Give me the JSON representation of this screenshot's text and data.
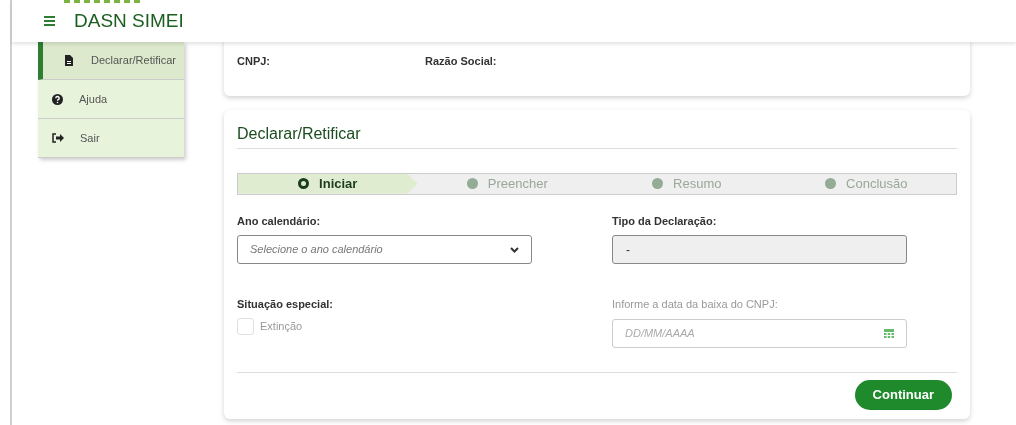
{
  "header": {
    "title": "DASN SIMEI"
  },
  "sidebar": {
    "items": [
      {
        "label": "Declarar/Retificar",
        "kind": "file",
        "selected": true
      },
      {
        "label": "Ajuda",
        "kind": "help",
        "selected": false
      },
      {
        "label": "Sair",
        "kind": "exit",
        "selected": false
      }
    ]
  },
  "company": {
    "cnpj_label": "CNPJ:",
    "razao_label": "Razão Social:"
  },
  "form": {
    "title": "Declarar/Retificar",
    "steps": [
      {
        "label": "Iniciar",
        "selected": true
      },
      {
        "label": "Preencher",
        "selected": false
      },
      {
        "label": "Resumo",
        "selected": false
      },
      {
        "label": "Conclusão",
        "selected": false
      }
    ],
    "ano": {
      "label": "Ano calendário:",
      "placeholder": "Selecione o ano calendário"
    },
    "tipo": {
      "label": "Tipo da Declaração:",
      "value": "-"
    },
    "situacao": {
      "label": "Situação especial:",
      "option": "Extinção",
      "checked": false,
      "disabled": true
    },
    "data_baixa": {
      "label": "Informe a data da baixa do CNPJ:",
      "placeholder": "DD/MM/AAAA",
      "disabled": true
    },
    "button": "Continuar"
  }
}
